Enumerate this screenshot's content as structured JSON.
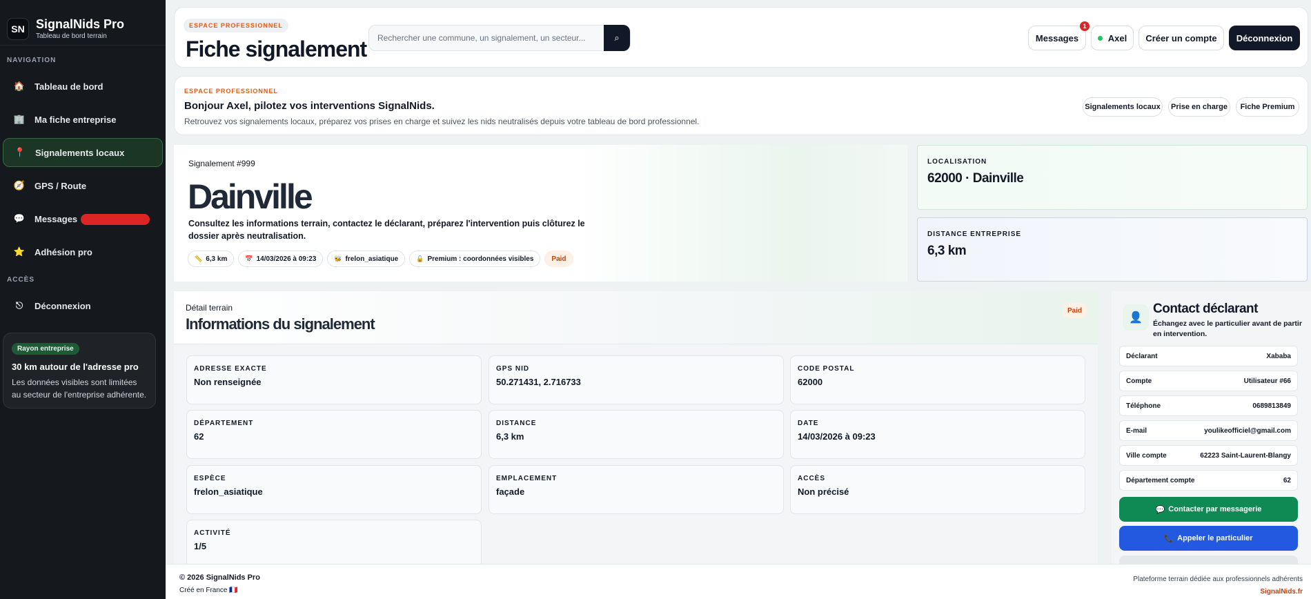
{
  "sidebar": {
    "logo": "SN",
    "brand": "SignalNids Pro",
    "brand_sub": "Tableau de bord terrain",
    "nav_heading": "NAVIGATION",
    "items": [
      {
        "label": "Tableau de bord",
        "icon": "🏠"
      },
      {
        "label": "Ma fiche entreprise",
        "icon": "🏢"
      },
      {
        "label": "Signalements locaux",
        "icon": "📍"
      },
      {
        "label": "GPS / Route",
        "icon": "🧭"
      },
      {
        "label": "Messages",
        "icon": "💬"
      },
      {
        "label": "Adhésion pro",
        "icon": "⭐"
      }
    ],
    "access_heading": "ACCÈS",
    "logout": {
      "label": "Déconnexion",
      "icon": "⎋"
    },
    "rayon": {
      "badge": "Rayon entreprise",
      "title": "30 km autour de l'adresse pro",
      "text": "Les données visibles sont limitées au secteur de l'entreprise adhérente."
    }
  },
  "header": {
    "eyebrow": "ESPACE PROFESSIONNEL",
    "title": "Fiche signalement",
    "search_placeholder": "Rechercher une commune, un signalement, un secteur...",
    "search_icon": "⌕",
    "messages_label": "Messages",
    "messages_count": "1",
    "user_label": "Axel",
    "create_label": "Créer un compte",
    "logout_label": "Déconnexion"
  },
  "welcome": {
    "eyebrow": "ESPACE PROFESSIONNEL",
    "title": "Bonjour Axel, pilotez vos interventions SignalNids.",
    "text": "Retrouvez vos signalements locaux, préparez vos prises en charge et suivez les nids neutralisés depuis votre tableau de bord professionnel.",
    "pills": [
      "Signalements locaux",
      "Prise en charge",
      "Fiche Premium"
    ]
  },
  "hero": {
    "kicker": "Signalement #999",
    "title": "Dainville",
    "desc": "Consultez les informations terrain, contactez le déclarant, préparez l'intervention puis clôturez le dossier après neutralisation.",
    "chips": [
      {
        "icon": "📏",
        "label": "6,3 km"
      },
      {
        "icon": "📅",
        "label": "14/03/2026 à 09:23"
      },
      {
        "icon": "🐝",
        "label": "frelon_asiatique"
      },
      {
        "icon": "🔓",
        "label": "Premium : coordonnées visibles"
      }
    ],
    "status": "Paid"
  },
  "location": {
    "label": "LOCALISATION",
    "value": "62000 · Dainville"
  },
  "distance": {
    "label": "DISTANCE ENTREPRISE",
    "value": "6,3 km"
  },
  "detail": {
    "kicker": "Détail terrain",
    "title": "Informations du signalement",
    "status": "Paid",
    "fields": [
      {
        "label": "ADRESSE EXACTE",
        "value": "Non renseignée"
      },
      {
        "label": "GPS NID",
        "value": "50.271431, 2.716733"
      },
      {
        "label": "CODE POSTAL",
        "value": "62000"
      },
      {
        "label": "DÉPARTEMENT",
        "value": "62"
      },
      {
        "label": "DISTANCE",
        "value": "6,3 km"
      },
      {
        "label": "DATE",
        "value": "14/03/2026 à 09:23"
      },
      {
        "label": "ESPÈCE",
        "value": "frelon_asiatique"
      },
      {
        "label": "EMPLACEMENT",
        "value": "façade"
      },
      {
        "label": "ACCÈS",
        "value": "Non précisé"
      },
      {
        "label": "ACTIVITÉ",
        "value": "1/5"
      }
    ]
  },
  "contact": {
    "avatar_icon": "👤",
    "title": "Contact déclarant",
    "sub": "Échangez avec le particulier avant de partir en intervention.",
    "rows": [
      {
        "label": "Déclarant",
        "value": "Xababa"
      },
      {
        "label": "Compte",
        "value": "Utilisateur #66"
      },
      {
        "label": "Téléphone",
        "value": "0689813849"
      },
      {
        "label": "E-mail",
        "value": "youlikeofficiel@gmail.com"
      },
      {
        "label": "Ville compte",
        "value": "62223 Saint-Laurent-Blangy"
      },
      {
        "label": "Département compte",
        "value": "62"
      }
    ],
    "message_btn": {
      "icon": "💬",
      "label": "Contacter par messagerie"
    },
    "call_btn": {
      "icon": "📞",
      "label": "Appeler le particulier"
    }
  },
  "footer": {
    "copy": "© 2026 SignalNids Pro",
    "made": "Créé en France 🇫🇷",
    "right": "Plateforme terrain dédiée aux professionnels adhérents",
    "link": "SignalNids.fr"
  },
  "colors": {
    "accent_orange": "#ea580c",
    "active_green": "#1c3626",
    "dark": "#111827",
    "call_blue": "#2359e0",
    "message_green": "#0f8a55"
  }
}
